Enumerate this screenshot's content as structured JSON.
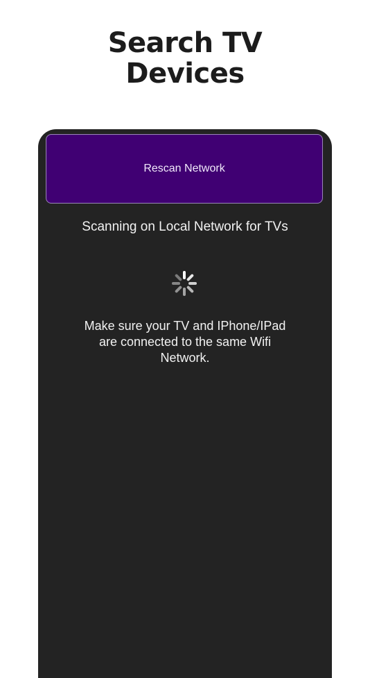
{
  "header": {
    "title_line1": "Search TV",
    "title_line2": "Devices"
  },
  "scanner": {
    "rescan_label": "Rescan Network",
    "status": "Scanning on Local Network for TVs",
    "hint": "Make sure your TV and IPhone/IPad are connected to the same Wifi Network."
  },
  "colors": {
    "button_bg": "#400073",
    "panel_bg": "#232323"
  },
  "icons": {
    "loading": "activity-spinner-icon"
  }
}
